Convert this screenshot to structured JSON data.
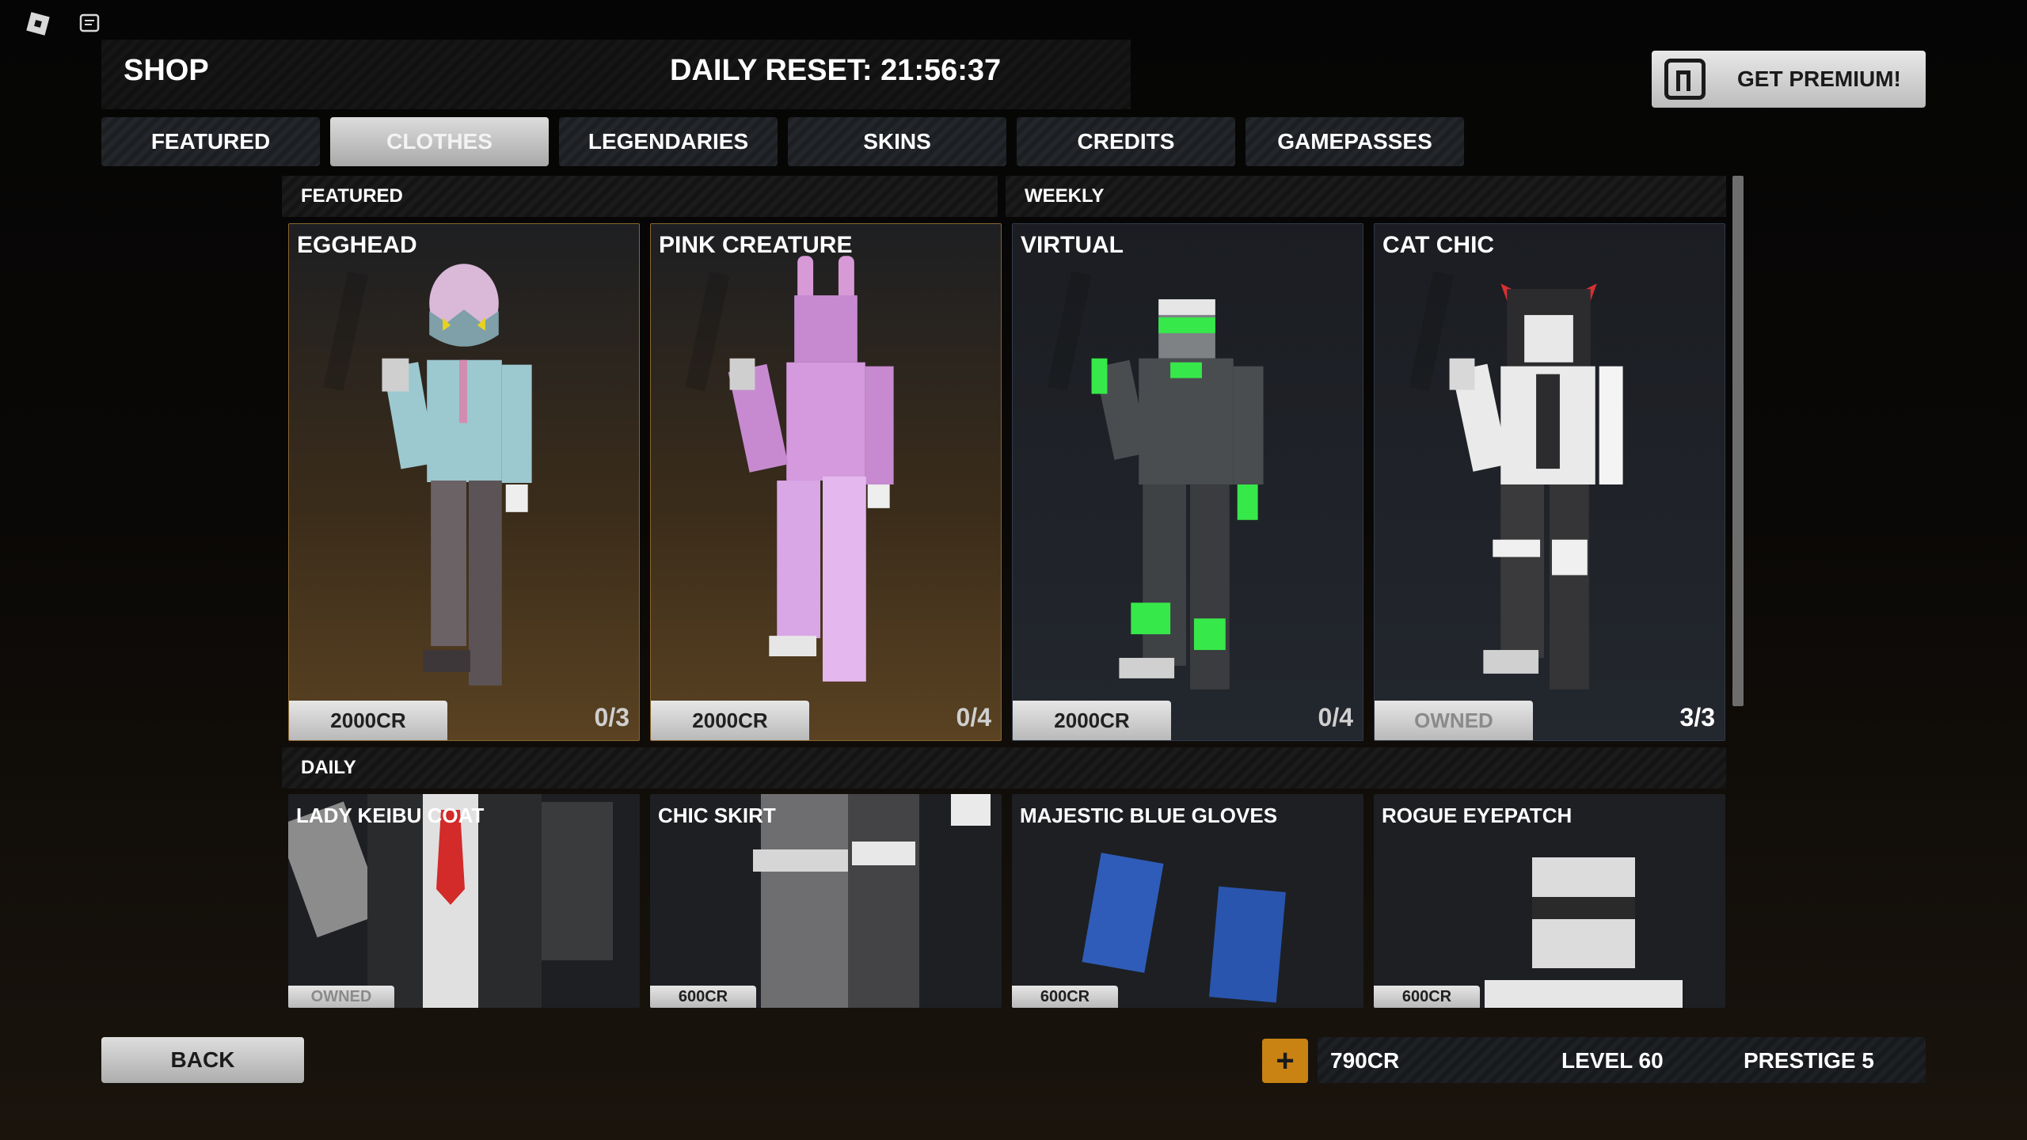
{
  "header": {
    "shop_title": "SHOP",
    "daily_reset": "DAILY RESET: 21:56:37",
    "premium_label": "GET PREMIUM!"
  },
  "tabs": [
    {
      "label": "FEATURED",
      "active": false
    },
    {
      "label": "CLOTHES",
      "active": true
    },
    {
      "label": "LEGENDARIES",
      "active": false
    },
    {
      "label": "SKINS",
      "active": false
    },
    {
      "label": "CREDITS",
      "active": false
    },
    {
      "label": "GAMEPASSES",
      "active": false
    }
  ],
  "sections": {
    "featured": "FEATURED",
    "weekly": "WEEKLY",
    "daily": "DAILY"
  },
  "featured_items": [
    {
      "name": "EGGHEAD",
      "price": "2000CR",
      "count": "0/3"
    },
    {
      "name": "PINK CREATURE",
      "price": "2000CR",
      "count": "0/4"
    }
  ],
  "weekly_items": [
    {
      "name": "VIRTUAL",
      "price": "2000CR",
      "count": "0/4"
    },
    {
      "name": "CAT CHIC",
      "price": "OWNED",
      "count": "3/3"
    }
  ],
  "daily_items": [
    {
      "name": "LADY KEIBU COAT",
      "price": "OWNED"
    },
    {
      "name": "CHIC SKIRT",
      "price": "600CR"
    },
    {
      "name": "MAJESTIC BLUE GLOVES",
      "price": "600CR"
    },
    {
      "name": "ROGUE EYEPATCH",
      "price": "600CR"
    }
  ],
  "footer": {
    "back_label": "BACK",
    "plus_label": "+",
    "credits": "790CR",
    "level": "LEVEL 60",
    "prestige": "PRESTIGE 5"
  },
  "colors": {
    "accent_gold": "#c98313",
    "featured_border": "#8a6530",
    "tab_active": "#c4c4c4"
  },
  "icons": {
    "top_left": [
      "roblox-logo-icon",
      "chat-icon"
    ],
    "premium": "premium-icon",
    "plus": "plus-icon"
  }
}
